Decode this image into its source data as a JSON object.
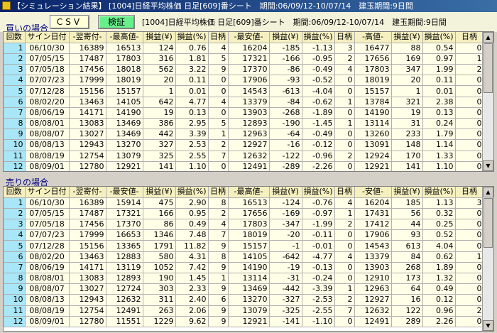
{
  "window": {
    "title": "【シミュレーション結果】 [1004]日経平均株価 日足[609]番シート　期間:06/09/12-10/07/14　建玉期間:9日間"
  },
  "toolbar": {
    "csv_label": "CSV",
    "verify_label": "検証",
    "info": "[1004]日経平均株価 日足[609]番シート　期間:06/09/12-10/07/14　建玉期間:9日間"
  },
  "buy": {
    "label": "買いの場合",
    "headers": [
      "回数",
      "サイン日付",
      "-翌寄付-",
      "-最高値-",
      "損益(¥)",
      "損益(%)",
      "日柄",
      "-最安値-",
      "損益(¥)",
      "損益(%)",
      "日柄",
      "-高値-",
      "損益(¥)",
      "損益(%)",
      "日柄"
    ],
    "rows": [
      [
        "1",
        "06/10/30",
        "16389",
        "16513",
        "124",
        "0.76",
        "4",
        "16204",
        "-185",
        "-1.13",
        "3",
        "16477",
        "88",
        "0.54",
        "0"
      ],
      [
        "2",
        "07/05/15",
        "17487",
        "17803",
        "316",
        "1.81",
        "5",
        "17321",
        "-166",
        "-0.95",
        "2",
        "17656",
        "169",
        "0.97",
        "1"
      ],
      [
        "3",
        "07/05/18",
        "17456",
        "18018",
        "562",
        "3.22",
        "9",
        "17370",
        "-86",
        "-0.49",
        "4",
        "17803",
        "347",
        "1.99",
        "2"
      ],
      [
        "4",
        "07/07/23",
        "17999",
        "18019",
        "20",
        "0.11",
        "0",
        "17906",
        "-93",
        "-0.52",
        "0",
        "18019",
        "20",
        "0.11",
        "0"
      ],
      [
        "5",
        "07/12/28",
        "15156",
        "15157",
        "1",
        "0.01",
        "0",
        "14543",
        "-613",
        "-4.04",
        "0",
        "15157",
        "1",
        "0.01",
        "0"
      ],
      [
        "6",
        "08/02/20",
        "13463",
        "14105",
        "642",
        "4.77",
        "4",
        "13379",
        "-84",
        "-0.62",
        "1",
        "13784",
        "321",
        "2.38",
        "0"
      ],
      [
        "7",
        "08/06/19",
        "14171",
        "14190",
        "19",
        "0.13",
        "0",
        "13903",
        "-268",
        "-1.89",
        "0",
        "14190",
        "19",
        "0.13",
        "0"
      ],
      [
        "8",
        "08/08/01",
        "13083",
        "13469",
        "386",
        "2.95",
        "5",
        "12893",
        "-190",
        "-1.45",
        "1",
        "13114",
        "31",
        "0.24",
        "0"
      ],
      [
        "9",
        "08/08/07",
        "13027",
        "13469",
        "442",
        "3.39",
        "1",
        "12963",
        "-64",
        "-0.49",
        "0",
        "13260",
        "233",
        "1.79",
        "0"
      ],
      [
        "10",
        "08/08/13",
        "12943",
        "13270",
        "327",
        "2.53",
        "2",
        "12927",
        "-16",
        "-0.12",
        "0",
        "13091",
        "148",
        "1.14",
        "0"
      ],
      [
        "11",
        "08/08/19",
        "12754",
        "13079",
        "325",
        "2.55",
        "7",
        "12632",
        "-122",
        "-0.96",
        "2",
        "12924",
        "170",
        "1.33",
        "0"
      ],
      [
        "12",
        "08/09/01",
        "12780",
        "12921",
        "141",
        "1.10",
        "0",
        "12491",
        "-289",
        "-2.26",
        "0",
        "12921",
        "141",
        "1.10",
        "0"
      ]
    ]
  },
  "sell": {
    "label": "売りの場合",
    "headers": [
      "回数",
      "サイン日付",
      "-翌寄付-",
      "-最安値-",
      "損益(¥)",
      "損益(%)",
      "日柄",
      "-最高値-",
      "損益(¥)",
      "損益(%)",
      "日柄",
      "-安値-",
      "損益(¥)",
      "損益(%)",
      "日柄"
    ],
    "rows": [
      [
        "1",
        "06/10/30",
        "16389",
        "15914",
        "475",
        "2.90",
        "8",
        "16513",
        "-124",
        "-0.76",
        "4",
        "16204",
        "185",
        "1.13",
        "3"
      ],
      [
        "2",
        "07/05/15",
        "17487",
        "17321",
        "166",
        "0.95",
        "2",
        "17656",
        "-169",
        "-0.97",
        "1",
        "17431",
        "56",
        "0.32",
        "0"
      ],
      [
        "3",
        "07/05/18",
        "17456",
        "17370",
        "86",
        "0.49",
        "4",
        "17803",
        "-347",
        "-1.99",
        "2",
        "17412",
        "44",
        "0.25",
        "0"
      ],
      [
        "4",
        "07/07/23",
        "17999",
        "16653",
        "1346",
        "7.48",
        "7",
        "18019",
        "-20",
        "-0.11",
        "0",
        "17906",
        "93",
        "0.52",
        "0"
      ],
      [
        "5",
        "07/12/28",
        "15156",
        "13365",
        "1791",
        "11.82",
        "9",
        "15157",
        "-1",
        "-0.01",
        "0",
        "14543",
        "613",
        "4.04",
        "0"
      ],
      [
        "6",
        "08/02/20",
        "13463",
        "12883",
        "580",
        "4.31",
        "8",
        "14105",
        "-642",
        "-4.77",
        "4",
        "13379",
        "84",
        "0.62",
        "1"
      ],
      [
        "7",
        "08/06/19",
        "14171",
        "13119",
        "1052",
        "7.42",
        "9",
        "14190",
        "-19",
        "-0.13",
        "0",
        "13903",
        "268",
        "1.89",
        "0"
      ],
      [
        "8",
        "08/08/01",
        "13083",
        "12893",
        "190",
        "1.45",
        "1",
        "13114",
        "-31",
        "-0.24",
        "0",
        "12910",
        "173",
        "1.32",
        "0"
      ],
      [
        "9",
        "08/08/07",
        "13027",
        "12724",
        "303",
        "2.33",
        "9",
        "13469",
        "-442",
        "-3.39",
        "1",
        "12963",
        "64",
        "0.49",
        "0"
      ],
      [
        "10",
        "08/08/13",
        "12943",
        "12632",
        "311",
        "2.40",
        "6",
        "13270",
        "-327",
        "-2.53",
        "2",
        "12927",
        "16",
        "0.12",
        "0"
      ],
      [
        "11",
        "08/08/19",
        "12754",
        "12491",
        "263",
        "2.06",
        "9",
        "13079",
        "-325",
        "-2.55",
        "7",
        "12632",
        "122",
        "0.96",
        "2"
      ],
      [
        "12",
        "08/09/01",
        "12780",
        "11551",
        "1229",
        "9.62",
        "9",
        "12921",
        "-141",
        "-1.10",
        "0",
        "12491",
        "289",
        "2.26",
        "0"
      ]
    ]
  },
  "colors": {
    "titlebar_start": "#0a246a",
    "header_bg": "#f6f0c0",
    "index_bg": "#a8e6f8",
    "verify_button": "#66f08a",
    "section_label": "#000080"
  }
}
